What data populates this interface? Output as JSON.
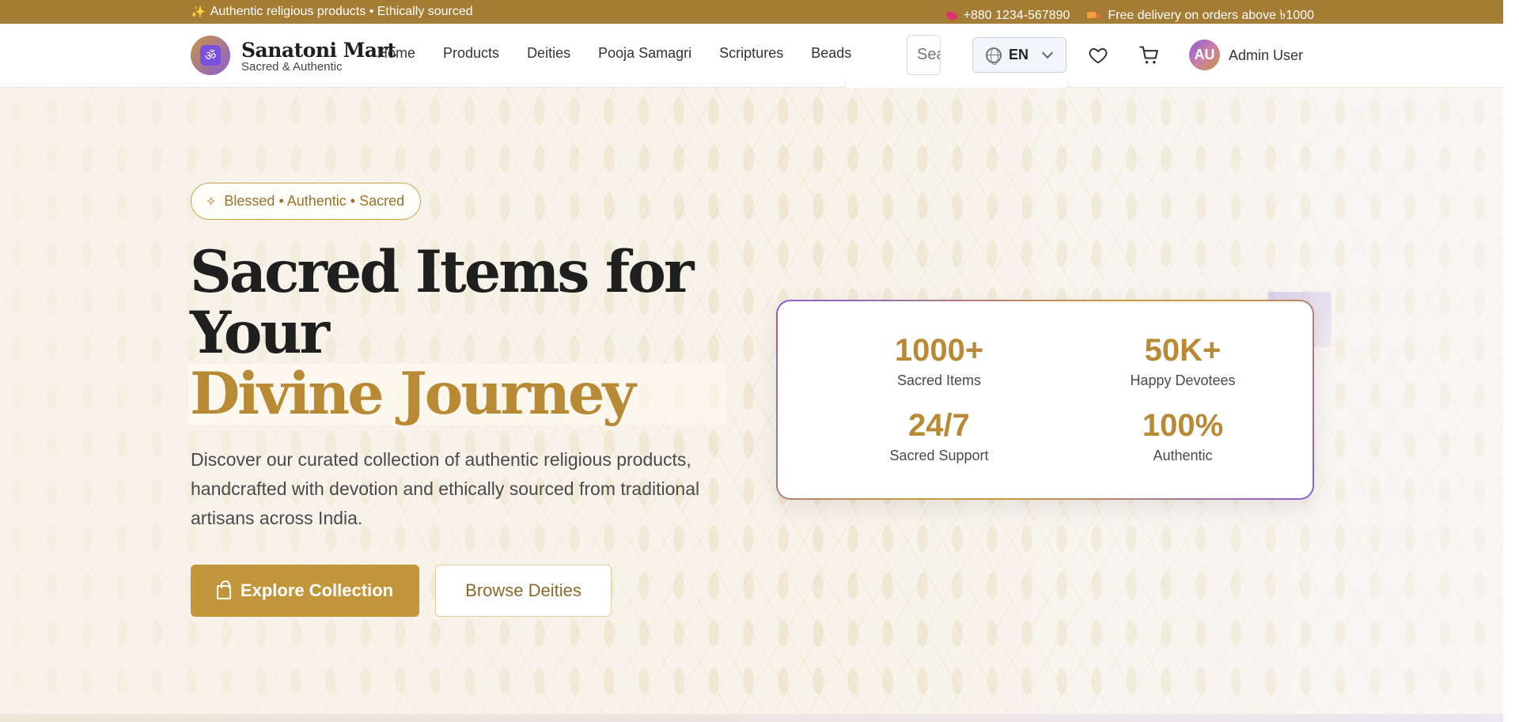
{
  "topbar": {
    "promo": "Authentic religious products • Ethically sourced",
    "phone": "+880 1234-567890",
    "delivery": "Free delivery on orders above ৳1000"
  },
  "brand": {
    "name": "Sanatoni Mart",
    "tagline": "Sacred & Authentic",
    "logo_symbol": "ॐ"
  },
  "nav": {
    "items": [
      "Home",
      "Products",
      "Deities",
      "Pooja Samagri",
      "Scriptures",
      "Beads"
    ]
  },
  "search": {
    "placeholder": "Search"
  },
  "language": {
    "selected": "EN"
  },
  "user": {
    "initials": "AU",
    "name": "Admin User"
  },
  "hero": {
    "badge": "Blessed • Authentic • Sacred",
    "title_line1": "Sacred Items for",
    "title_line2": "Your",
    "title_highlight": "Divine Journey",
    "description": "Discover our curated collection of authentic religious products, handcrafted with devotion and ethically sourced from traditional artisans across India.",
    "primary_button": "Explore Collection",
    "secondary_button": "Browse Deities"
  },
  "stats": [
    {
      "value": "1000+",
      "label": "Sacred Items"
    },
    {
      "value": "50K+",
      "label": "Happy Devotees"
    },
    {
      "value": "24/7",
      "label": "Sacred Support"
    },
    {
      "value": "100%",
      "label": "Authentic"
    }
  ],
  "colors": {
    "topbar": "#a57c33",
    "accent_gold": "#b98a35",
    "button_gold": "#c2963b",
    "accent_purple": "#8a5cd6"
  },
  "icons": {
    "promo": "sparkles-icon",
    "phone": "phone-icon",
    "delivery": "truck-icon",
    "language": "globe-icon",
    "wishlist": "heart-icon",
    "cart": "cart-icon",
    "badge": "sparkle-icon",
    "primary_button": "shopping-bag-icon"
  }
}
